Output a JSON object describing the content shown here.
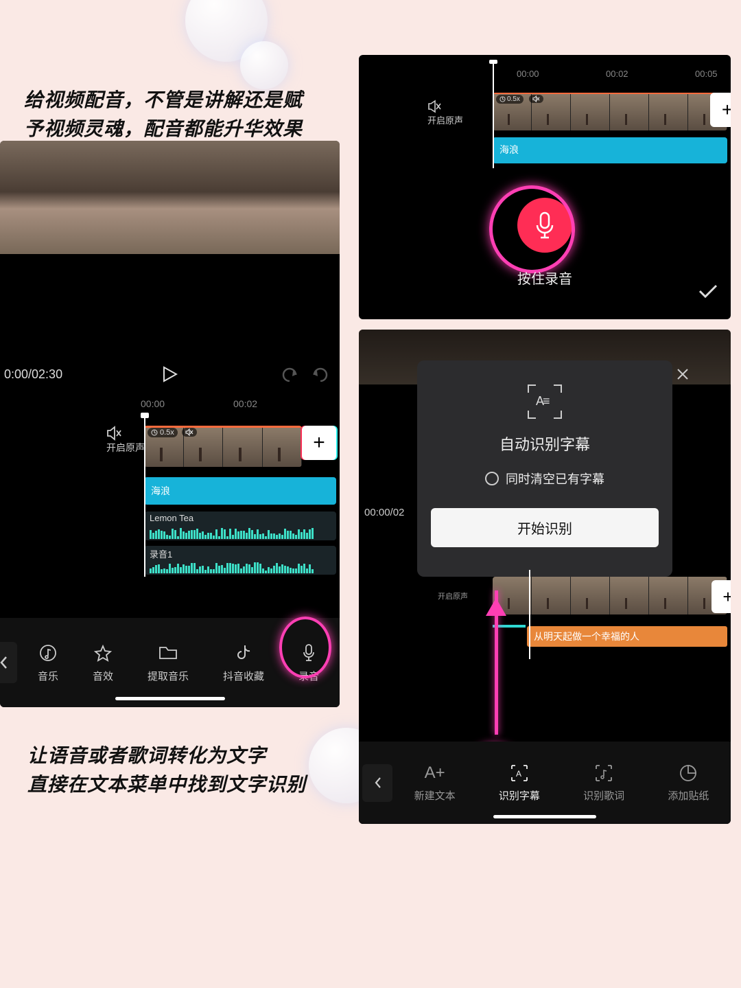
{
  "captions": {
    "top_line1": "给视频配音，不管是讲解还是赋",
    "top_line2": "予视频灵魂，配音都能升华效果",
    "bottom_line1": "让语音或者歌词转化为文字",
    "bottom_line2": "直接在文本菜单中找到文字识别"
  },
  "left_panel": {
    "time": "0:00/02:30",
    "timeline_labels": [
      "00:00",
      "00:02"
    ],
    "mute_label": "开启原声",
    "clip_speed": "0.5x",
    "tracks": {
      "t1": "海浪",
      "t2": "Lemon Tea",
      "t3": "录音1"
    },
    "toolbar": [
      {
        "label": "音乐"
      },
      {
        "label": "音效"
      },
      {
        "label": "提取音乐"
      },
      {
        "label": "抖音收藏"
      },
      {
        "label": "录音"
      }
    ]
  },
  "tr_panel": {
    "timeline_labels": [
      "00:00",
      "00:02",
      "00:05"
    ],
    "mute_label": "开启原声",
    "clip_speed": "0.5x",
    "track1": "海浪",
    "record_label": "按住录音"
  },
  "br_panel": {
    "dialog_title": "自动识别字幕",
    "dialog_check": "同时清空已有字幕",
    "dialog_button": "开始识别",
    "time": "00:00/02",
    "mute_label": "开启原声",
    "subtitle_text": "从明天起做一个幸福的人",
    "toolbar": [
      {
        "label": "新建文本"
      },
      {
        "label": "识别字幕"
      },
      {
        "label": "识别歌词"
      },
      {
        "label": "添加贴纸"
      }
    ]
  }
}
